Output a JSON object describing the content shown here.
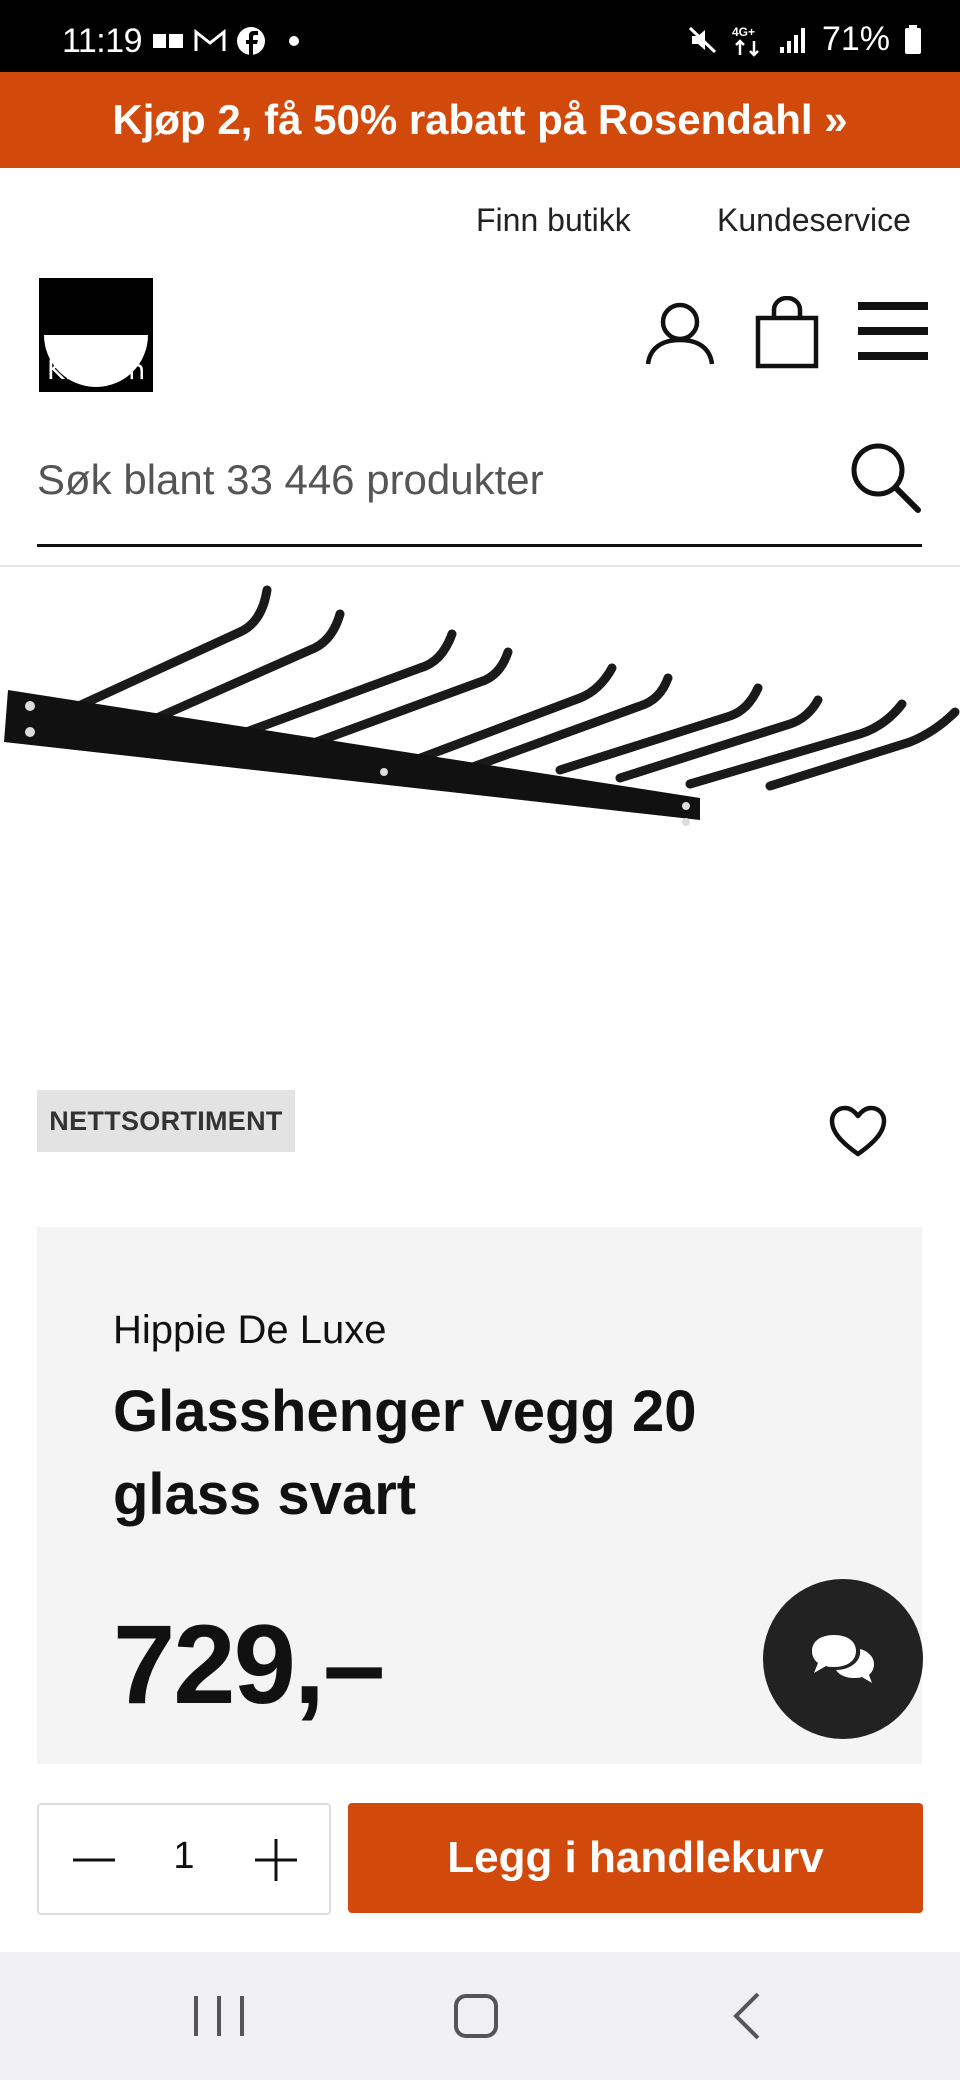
{
  "status_bar": {
    "time": "11:19",
    "network": "4G+",
    "battery": "71%"
  },
  "promo": {
    "text": "Kjøp 2, få 50% rabatt på Rosendahl »"
  },
  "header": {
    "links": [
      "Finn butikk",
      "Kundeservice"
    ],
    "logo_text": "Kitch´n"
  },
  "search": {
    "placeholder": "Søk blant 33 446 produkter"
  },
  "product": {
    "badge": "NETTSORTIMENT",
    "brand": "Hippie De Luxe",
    "title": "Glasshenger vegg 20 glass svart",
    "price": "729,–",
    "quantity": "1",
    "add_to_cart": "Legg i handlekurv"
  },
  "colors": {
    "accent": "#d24a0b",
    "card_bg": "#f4f4f4",
    "badge_bg": "#e3e3e3"
  },
  "icons": {
    "header": [
      "user-icon",
      "cart-icon",
      "menu-icon",
      "search-icon"
    ],
    "product": [
      "heart-icon",
      "chat-icon"
    ],
    "system_nav": [
      "recent-apps-icon",
      "home-icon",
      "back-icon"
    ]
  }
}
